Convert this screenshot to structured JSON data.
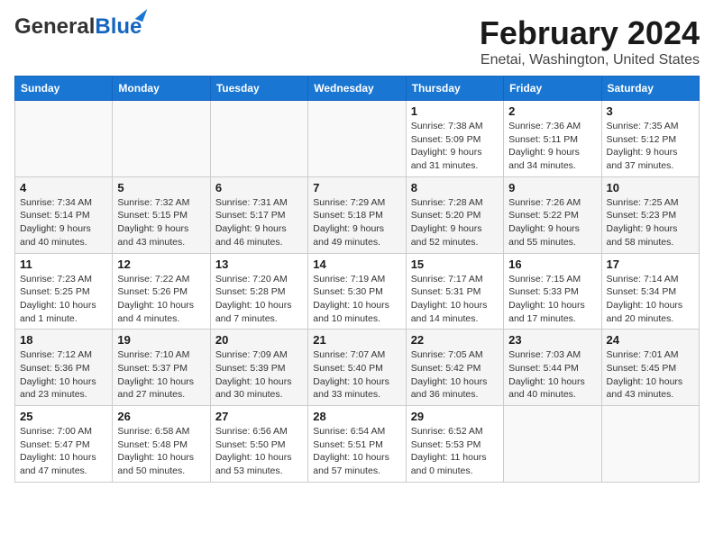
{
  "header": {
    "logo_general": "General",
    "logo_blue": "Blue",
    "month_title": "February 2024",
    "location": "Enetai, Washington, United States"
  },
  "days_of_week": [
    "Sunday",
    "Monday",
    "Tuesday",
    "Wednesday",
    "Thursday",
    "Friday",
    "Saturday"
  ],
  "weeks": [
    [
      {
        "day": "",
        "sunrise": "",
        "sunset": "",
        "daylight": ""
      },
      {
        "day": "",
        "sunrise": "",
        "sunset": "",
        "daylight": ""
      },
      {
        "day": "",
        "sunrise": "",
        "sunset": "",
        "daylight": ""
      },
      {
        "day": "",
        "sunrise": "",
        "sunset": "",
        "daylight": ""
      },
      {
        "day": "1",
        "sunrise": "Sunrise: 7:38 AM",
        "sunset": "Sunset: 5:09 PM",
        "daylight": "Daylight: 9 hours and 31 minutes."
      },
      {
        "day": "2",
        "sunrise": "Sunrise: 7:36 AM",
        "sunset": "Sunset: 5:11 PM",
        "daylight": "Daylight: 9 hours and 34 minutes."
      },
      {
        "day": "3",
        "sunrise": "Sunrise: 7:35 AM",
        "sunset": "Sunset: 5:12 PM",
        "daylight": "Daylight: 9 hours and 37 minutes."
      }
    ],
    [
      {
        "day": "4",
        "sunrise": "Sunrise: 7:34 AM",
        "sunset": "Sunset: 5:14 PM",
        "daylight": "Daylight: 9 hours and 40 minutes."
      },
      {
        "day": "5",
        "sunrise": "Sunrise: 7:32 AM",
        "sunset": "Sunset: 5:15 PM",
        "daylight": "Daylight: 9 hours and 43 minutes."
      },
      {
        "day": "6",
        "sunrise": "Sunrise: 7:31 AM",
        "sunset": "Sunset: 5:17 PM",
        "daylight": "Daylight: 9 hours and 46 minutes."
      },
      {
        "day": "7",
        "sunrise": "Sunrise: 7:29 AM",
        "sunset": "Sunset: 5:18 PM",
        "daylight": "Daylight: 9 hours and 49 minutes."
      },
      {
        "day": "8",
        "sunrise": "Sunrise: 7:28 AM",
        "sunset": "Sunset: 5:20 PM",
        "daylight": "Daylight: 9 hours and 52 minutes."
      },
      {
        "day": "9",
        "sunrise": "Sunrise: 7:26 AM",
        "sunset": "Sunset: 5:22 PM",
        "daylight": "Daylight: 9 hours and 55 minutes."
      },
      {
        "day": "10",
        "sunrise": "Sunrise: 7:25 AM",
        "sunset": "Sunset: 5:23 PM",
        "daylight": "Daylight: 9 hours and 58 minutes."
      }
    ],
    [
      {
        "day": "11",
        "sunrise": "Sunrise: 7:23 AM",
        "sunset": "Sunset: 5:25 PM",
        "daylight": "Daylight: 10 hours and 1 minute."
      },
      {
        "day": "12",
        "sunrise": "Sunrise: 7:22 AM",
        "sunset": "Sunset: 5:26 PM",
        "daylight": "Daylight: 10 hours and 4 minutes."
      },
      {
        "day": "13",
        "sunrise": "Sunrise: 7:20 AM",
        "sunset": "Sunset: 5:28 PM",
        "daylight": "Daylight: 10 hours and 7 minutes."
      },
      {
        "day": "14",
        "sunrise": "Sunrise: 7:19 AM",
        "sunset": "Sunset: 5:30 PM",
        "daylight": "Daylight: 10 hours and 10 minutes."
      },
      {
        "day": "15",
        "sunrise": "Sunrise: 7:17 AM",
        "sunset": "Sunset: 5:31 PM",
        "daylight": "Daylight: 10 hours and 14 minutes."
      },
      {
        "day": "16",
        "sunrise": "Sunrise: 7:15 AM",
        "sunset": "Sunset: 5:33 PM",
        "daylight": "Daylight: 10 hours and 17 minutes."
      },
      {
        "day": "17",
        "sunrise": "Sunrise: 7:14 AM",
        "sunset": "Sunset: 5:34 PM",
        "daylight": "Daylight: 10 hours and 20 minutes."
      }
    ],
    [
      {
        "day": "18",
        "sunrise": "Sunrise: 7:12 AM",
        "sunset": "Sunset: 5:36 PM",
        "daylight": "Daylight: 10 hours and 23 minutes."
      },
      {
        "day": "19",
        "sunrise": "Sunrise: 7:10 AM",
        "sunset": "Sunset: 5:37 PM",
        "daylight": "Daylight: 10 hours and 27 minutes."
      },
      {
        "day": "20",
        "sunrise": "Sunrise: 7:09 AM",
        "sunset": "Sunset: 5:39 PM",
        "daylight": "Daylight: 10 hours and 30 minutes."
      },
      {
        "day": "21",
        "sunrise": "Sunrise: 7:07 AM",
        "sunset": "Sunset: 5:40 PM",
        "daylight": "Daylight: 10 hours and 33 minutes."
      },
      {
        "day": "22",
        "sunrise": "Sunrise: 7:05 AM",
        "sunset": "Sunset: 5:42 PM",
        "daylight": "Daylight: 10 hours and 36 minutes."
      },
      {
        "day": "23",
        "sunrise": "Sunrise: 7:03 AM",
        "sunset": "Sunset: 5:44 PM",
        "daylight": "Daylight: 10 hours and 40 minutes."
      },
      {
        "day": "24",
        "sunrise": "Sunrise: 7:01 AM",
        "sunset": "Sunset: 5:45 PM",
        "daylight": "Daylight: 10 hours and 43 minutes."
      }
    ],
    [
      {
        "day": "25",
        "sunrise": "Sunrise: 7:00 AM",
        "sunset": "Sunset: 5:47 PM",
        "daylight": "Daylight: 10 hours and 47 minutes."
      },
      {
        "day": "26",
        "sunrise": "Sunrise: 6:58 AM",
        "sunset": "Sunset: 5:48 PM",
        "daylight": "Daylight: 10 hours and 50 minutes."
      },
      {
        "day": "27",
        "sunrise": "Sunrise: 6:56 AM",
        "sunset": "Sunset: 5:50 PM",
        "daylight": "Daylight: 10 hours and 53 minutes."
      },
      {
        "day": "28",
        "sunrise": "Sunrise: 6:54 AM",
        "sunset": "Sunset: 5:51 PM",
        "daylight": "Daylight: 10 hours and 57 minutes."
      },
      {
        "day": "29",
        "sunrise": "Sunrise: 6:52 AM",
        "sunset": "Sunset: 5:53 PM",
        "daylight": "Daylight: 11 hours and 0 minutes."
      },
      {
        "day": "",
        "sunrise": "",
        "sunset": "",
        "daylight": ""
      },
      {
        "day": "",
        "sunrise": "",
        "sunset": "",
        "daylight": ""
      }
    ]
  ]
}
